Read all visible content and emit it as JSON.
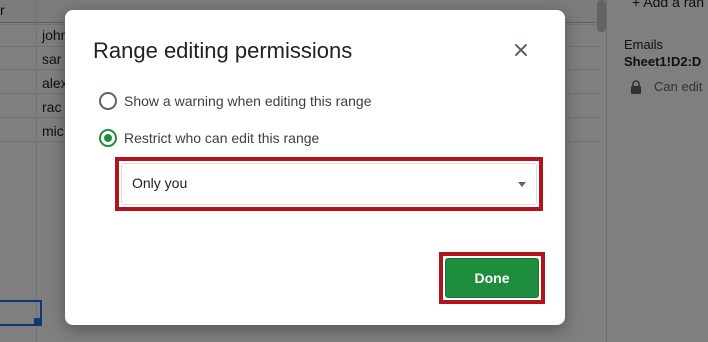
{
  "sheet": {
    "header_fragment": "r",
    "names": [
      "john",
      "sar",
      "alex",
      "rac",
      "mic"
    ]
  },
  "side_panel": {
    "top_text": "+ Add a ran",
    "label": "Emails",
    "range": "Sheet1!D2:D",
    "permission": "Can edit",
    "lock_icon": "lock-icon"
  },
  "dialog": {
    "title": "Range editing permissions",
    "close_icon": "close-icon",
    "options": [
      {
        "label": "Show a warning when editing this range",
        "selected": false
      },
      {
        "label": "Restrict who can edit this range",
        "selected": true
      }
    ],
    "select": {
      "value": "Only you"
    },
    "done_label": "Done"
  },
  "colors": {
    "accent": "#1e8e3e",
    "highlight": "#b3131b",
    "overlay": "rgba(0,0,0,0.5)"
  }
}
